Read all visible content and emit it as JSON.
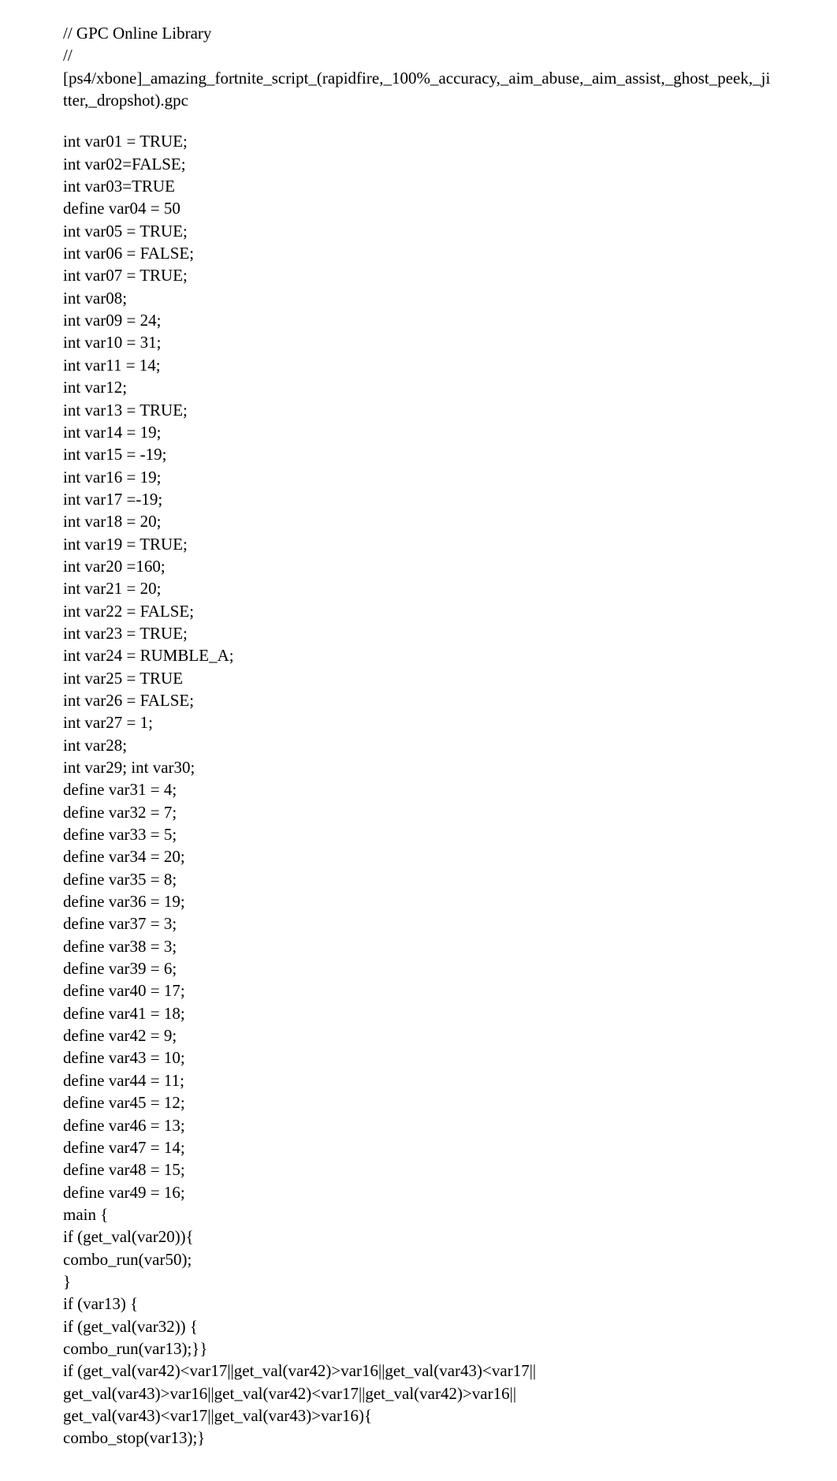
{
  "code_lines": [
    "// GPC Online Library",
    "//",
    "[ps4/xbone]_amazing_fortnite_script_(rapidfire,_100%_accuracy,_aim_abuse,_aim_assist,_ghost_peek,_jitter,_dropshot).gpc",
    "",
    "int var01 = TRUE;",
    "int var02=FALSE;",
    "int var03=TRUE",
    "define var04 = 50",
    "int var05 = TRUE;",
    "int var06 = FALSE;",
    "int var07 = TRUE;",
    "int var08;",
    "int var09 = 24;",
    "int var10 = 31;",
    "int var11 = 14;",
    "int var12;",
    "int var13 = TRUE;",
    "int var14 = 19;",
    "int var15 = -19;",
    "int var16 = 19;",
    "int var17 =-19;",
    "int var18 = 20;",
    "int var19 = TRUE;",
    "int var20 =160;",
    "int var21 = 20;",
    "int var22 = FALSE;",
    "int var23 = TRUE;",
    "int var24 = RUMBLE_A;",
    "int var25 = TRUE",
    "int var26 = FALSE;",
    "int var27 = 1;",
    "int var28;",
    "int var29; int var30;",
    "define var31 = 4;",
    "define var32 = 7;",
    "define var33 = 5;",
    "define var34 = 20;",
    "define var35 = 8;",
    "define var36 = 19;",
    "define var37 = 3;",
    "define var38 = 3;",
    "define var39 = 6;",
    "define var40 = 17;",
    "define var41 = 18;",
    "define var42 = 9;",
    "define var43 = 10;",
    "define var44 = 11;",
    "define var45 = 12;",
    "define var46 = 13;",
    "define var47 = 14;",
    "define var48 = 15;",
    "define var49 = 16;",
    "main {",
    "if (get_val(var20)){",
    "combo_run(var50);",
    "}",
    "if (var13) {",
    "if (get_val(var32)) {",
    "combo_run(var13);}}",
    "if (get_val(var42)<var17||get_val(var42)>var16||get_val(var43)<var17||",
    "get_val(var43)>var16||get_val(var42)<var17||get_val(var42)>var16||",
    "get_val(var43)<var17||get_val(var43)>var16){",
    "combo_stop(var13);}"
  ]
}
